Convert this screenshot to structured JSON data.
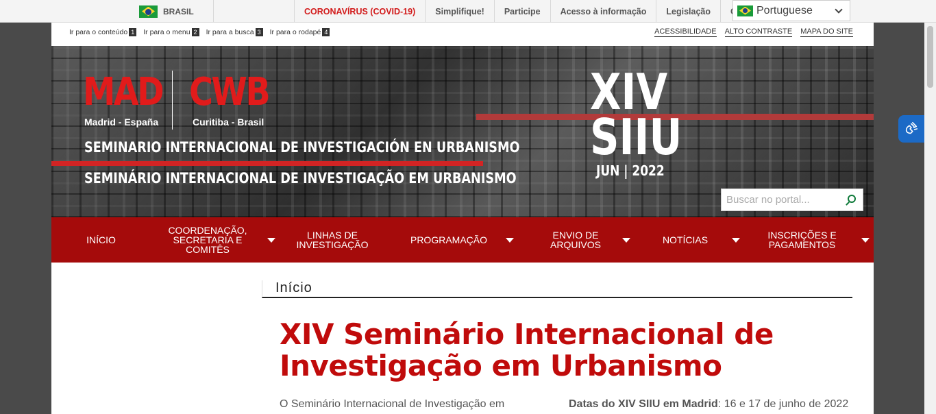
{
  "govbar": {
    "country": "BRASIL",
    "links": [
      "CORONAVÍRUS (COVID-19)",
      "Simplifique!",
      "Participe",
      "Acesso à informação",
      "Legislação",
      "C"
    ],
    "language": "Portuguese"
  },
  "skip_links": [
    {
      "label": "Ir para o conteúdo",
      "key": "1"
    },
    {
      "label": "Ir para o menu",
      "key": "2"
    },
    {
      "label": "Ir para a busca",
      "key": "3"
    },
    {
      "label": "Ir para o rodapé",
      "key": "4"
    }
  ],
  "accessibility": [
    "ACESSIBILIDADE",
    "ALTO CONTRASTE",
    "MAPA DO SITE"
  ],
  "banner": {
    "mad": "MAD",
    "cwb": "CWB",
    "city1": "Madrid - España",
    "city2": "Curitiba - Brasil",
    "title_es": "SEMINARIO INTERNACIONAL DE INVESTIGACIÓN EN URBANISMO",
    "title_pt": "SEMINÁRIO INTERNACIONAL DE INVESTIGAÇÃO EM URBANISMO",
    "edition_line1": "XIV",
    "edition_line2": "SIIU",
    "date": "JUN | 2022"
  },
  "search": {
    "placeholder": "Buscar no portal..."
  },
  "nav": [
    {
      "label": "INÍCIO"
    },
    {
      "label": "COORDENAÇÃO, SECRETARIA E COMITÊS"
    },
    {
      "label": "LINHAS DE INVESTIGAÇÃO"
    },
    {
      "label": "PROGRAMAÇÃO"
    },
    {
      "label": "ENVIO DE ARQUIVOS"
    },
    {
      "label": "NOTÍCIAS"
    },
    {
      "label": "INSCRIÇÕES E PAGAMENTOS"
    }
  ],
  "content": {
    "breadcrumb": "Início",
    "title": "XIV Seminário Internacional de Investigação em Urbanismo",
    "intro": "O Seminário Internacional de Investigação em",
    "dates_label": "Datas do XIV SIIU em Madrid",
    "dates_value": ": 16 e 17 de junho de 2022"
  },
  "colors": {
    "accent": "#a50b0b",
    "title": "#c00b0b",
    "covid": "#d21b1b"
  }
}
